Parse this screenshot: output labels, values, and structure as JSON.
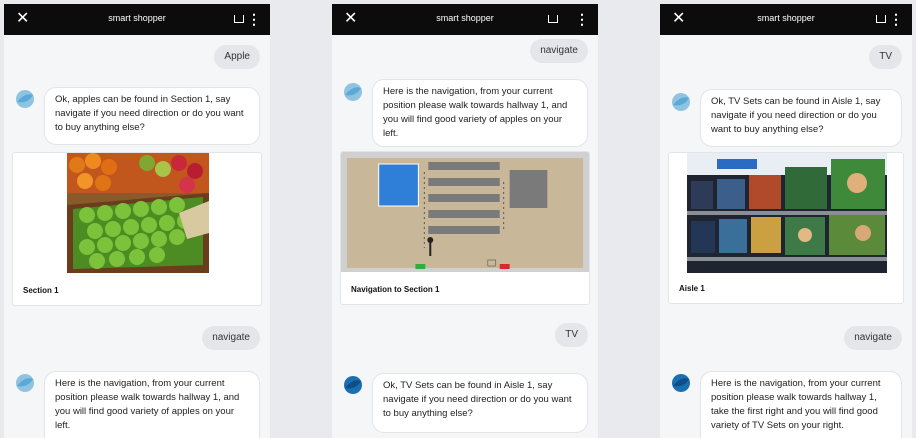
{
  "app": {
    "title": "smart shopper",
    "close_icon": "close-icon",
    "inbox_icon": "inbox-icon",
    "menu_icon": "more-vertical-icon",
    "colors": {
      "header": "#0c0c0c",
      "bot_avatar": "#3aa0d8",
      "bubble_user": "#e4e6ea"
    }
  },
  "screens": [
    {
      "messages": [
        {
          "from": "user",
          "text": "Apple"
        },
        {
          "from": "bot",
          "text": "Ok, apples can be found in Section 1, say navigate if you need direction or do you want to buy anything else?"
        },
        {
          "type": "card",
          "caption": "Section 1",
          "image": "apples-photo"
        },
        {
          "from": "user",
          "text": "navigate"
        },
        {
          "from": "bot",
          "text": "Here is the navigation, from your current position please walk towards hallway 1, and you will find good variety of apples on your left."
        }
      ]
    },
    {
      "messages": [
        {
          "from": "user",
          "text": "navigate"
        },
        {
          "from": "bot",
          "text": "Here is the navigation, from your current position please walk towards hallway 1, and you will find good variety of apples on your left."
        },
        {
          "type": "card",
          "caption": "Navigation to Section 1",
          "image": "store-map"
        },
        {
          "from": "user",
          "text": "TV"
        },
        {
          "from": "bot",
          "text": "Ok, TV Sets can be found in Aisle 1, say navigate if you need direction or do you want to buy anything else?"
        }
      ]
    },
    {
      "messages": [
        {
          "from": "user",
          "text": "TV"
        },
        {
          "from": "bot",
          "text": "Ok, TV Sets can be found in Aisle 1, say navigate if you need direction or do you want to buy anything else?"
        },
        {
          "type": "card",
          "caption": "Aisle 1",
          "image": "tv-store-photo"
        },
        {
          "from": "user",
          "text": "navigate"
        },
        {
          "from": "bot",
          "text": "Here is the navigation, from your current position please walk towards hallway 1, take the first right and you will find good variety of TV Sets on your right."
        }
      ]
    }
  ]
}
